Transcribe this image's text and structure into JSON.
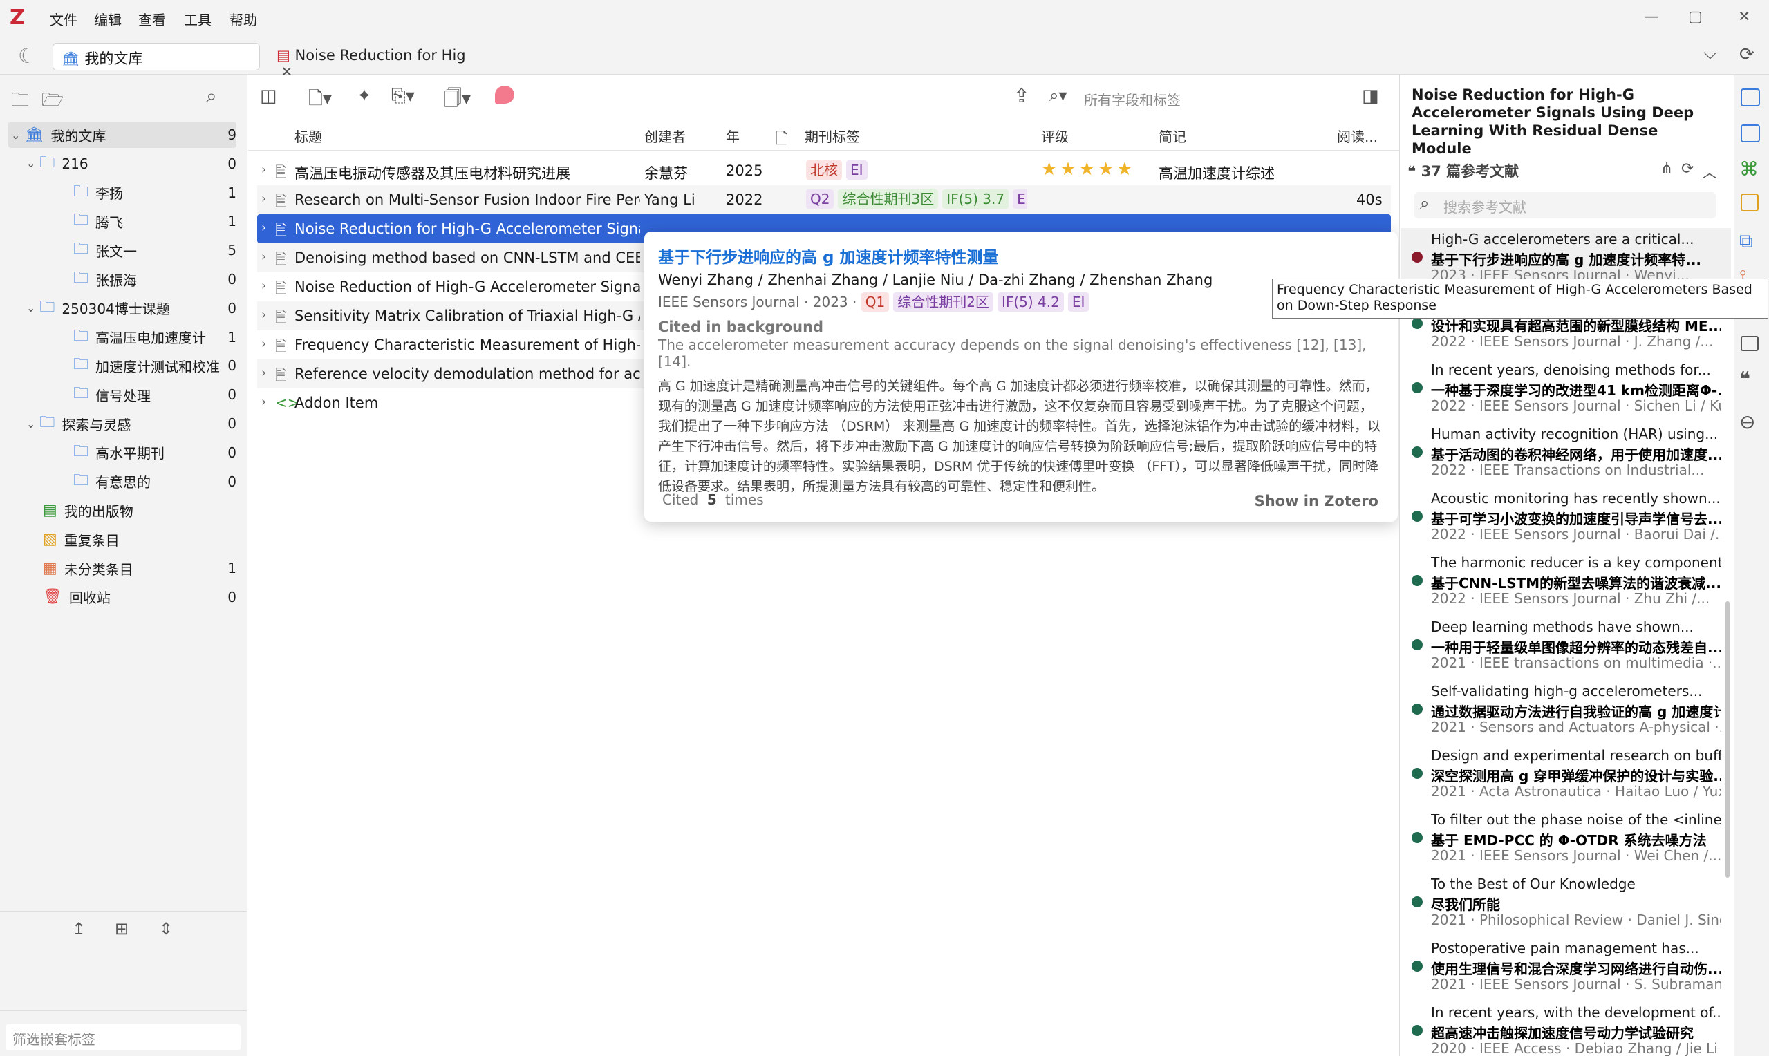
{
  "app": {
    "logo": "Z"
  },
  "menu": [
    "文件",
    "编辑",
    "查看",
    "工具",
    "帮助"
  ],
  "window": {
    "min": "—",
    "max": "▢",
    "close": "✕"
  },
  "tabs": {
    "library": "我的文库",
    "doc": "Noise Reduction for Hig",
    "close": "✕"
  },
  "collections": [
    {
      "name": "我的文库",
      "count": "9",
      "level": 0,
      "type": "lib",
      "expanded": true,
      "selected": true
    },
    {
      "name": "216",
      "count": "0",
      "level": 1,
      "type": "folder",
      "expanded": true
    },
    {
      "name": "李扬",
      "count": "1",
      "level": 2,
      "type": "folder"
    },
    {
      "name": "腾飞",
      "count": "1",
      "level": 2,
      "type": "folder"
    },
    {
      "name": "张文一",
      "count": "5",
      "level": 2,
      "type": "folder"
    },
    {
      "name": "张振海",
      "count": "0",
      "level": 2,
      "type": "folder"
    },
    {
      "name": "250304博士课题",
      "count": "0",
      "level": 1,
      "type": "folder",
      "expanded": true
    },
    {
      "name": "高温压电加速度计",
      "count": "1",
      "level": 2,
      "type": "folder"
    },
    {
      "name": "加速度计测试和校准",
      "count": "0",
      "level": 2,
      "type": "folder"
    },
    {
      "name": "信号处理",
      "count": "0",
      "level": 2,
      "type": "folder"
    },
    {
      "name": "探索与灵感",
      "count": "0",
      "level": 1,
      "type": "folder",
      "expanded": true
    },
    {
      "name": "高水平期刊",
      "count": "0",
      "level": 2,
      "type": "folder"
    },
    {
      "name": "有意思的",
      "count": "0",
      "level": 2,
      "type": "folder"
    },
    {
      "name": "我的出版物",
      "count": "",
      "level": 1,
      "type": "pub"
    },
    {
      "name": "重复条目",
      "count": "",
      "level": 1,
      "type": "dup"
    },
    {
      "name": "未分类条目",
      "count": "1",
      "level": 1,
      "type": "unfiled"
    },
    {
      "name": "回收站",
      "count": "0",
      "level": 1,
      "type": "trash"
    }
  ],
  "tag_filter_placeholder": "筛选嵌套标签",
  "search_placeholder": "所有字段和标签",
  "columns": {
    "title": "标题",
    "creator": "创建者",
    "year": "年",
    "tags": "期刊标签",
    "rating": "评级",
    "extra": "简记",
    "read": "阅读..."
  },
  "items": [
    {
      "title": "高温压电振动传感器及其压电材料研究进展",
      "creator": "余慧芬",
      "year": "2025",
      "tags": [
        {
          "t": "北核",
          "c": "red"
        },
        {
          "t": "EI",
          "c": "pur"
        }
      ],
      "rating": 5,
      "extra": "高温加速度计综述",
      "read": ""
    },
    {
      "title": "Research on Multi-Sensor Fusion Indoor Fire Percep",
      "creator": "Yang Li",
      "year": "2022",
      "tags": [
        {
          "t": "Q2",
          "c": "pur"
        },
        {
          "t": "综合性期刊3区",
          "c": "grn"
        },
        {
          "t": "IF(5) 3.7",
          "c": "grn"
        },
        {
          "t": "EI",
          "c": "pur"
        }
      ],
      "rating": 0,
      "extra": "",
      "read": "40s"
    },
    {
      "title": "Noise Reduction for High-G Accelerometer Signals U",
      "creator": "",
      "year": "",
      "tags": [],
      "rating": 0,
      "extra": "",
      "read": "",
      "selected": true
    },
    {
      "title": "Denoising method based on CNN-LSTM and CEEMD",
      "creator": "",
      "year": "",
      "tags": [],
      "rating": 0,
      "extra": "",
      "read": ""
    },
    {
      "title": "Noise Reduction of High-G Accelerometer Signals B",
      "creator": "",
      "year": "",
      "tags": [],
      "rating": 0,
      "extra": "",
      "read": ""
    },
    {
      "title": "Sensitivity Matrix Calibration of Triaxial High-G Acce",
      "creator": "",
      "year": "",
      "tags": [],
      "rating": 0,
      "extra": "",
      "read": ""
    },
    {
      "title": "Frequency Characteristic Measurement of High-G Ac",
      "creator": "",
      "year": "",
      "tags": [],
      "rating": 0,
      "extra": "",
      "read": ""
    },
    {
      "title": "Reference velocity demodulation method for accele",
      "creator": "",
      "year": "",
      "tags": [],
      "rating": 0,
      "extra": "",
      "read": ""
    },
    {
      "title": "Addon Item",
      "creator": "",
      "year": "",
      "tags": [],
      "rating": 0,
      "extra": "",
      "read": "",
      "addon": true
    }
  ],
  "popup": {
    "title": "基于下行步进响应的高 g 加速度计频率特性测量",
    "authors": "Wenyi Zhang / Zhenhai Zhang / Lanjie Niu / Da-zhi Zhang / Zhenshan Zhang",
    "journal": "IEEE Sensors Journal",
    "sep": "·",
    "year": "2023",
    "tags": [
      {
        "t": "Q1",
        "c": "red"
      },
      {
        "t": "综合性期刊2区",
        "c": "pur"
      },
      {
        "t": "IF(5) 4.2",
        "c": "pur"
      },
      {
        "t": "EI",
        "c": "pur"
      }
    ],
    "cited_in": "Cited in background",
    "context": "The accelerometer measurement accuracy depends on the signal denoising's effectiveness [12], [13], [14].",
    "abstract": "高 G 加速度计是精确测量高冲击信号的关键组件。每个高 G 加速度计都必须进行频率校准，以确保其测量的可靠性。然而，现有的测量高 G 加速度计频率响应的方法使用正弦冲击进行激励，这不仅复杂而且容易受到噪声干扰。为了克服这个问题，我们提出了一种下步响应方法 （DSRM） 来测量高 G 加速度计的频率特性。首先，选择泡沫铝作为冲击试验的缓冲材料，以产生下行冲击信号。然后，将下步冲击激励下高 G 加速度计的响应信号转换为阶跃响应信号;最后，提取阶跃响应信号中的特征，计算加速度计的频率特性。实验结果表明，DSRM 优于传统的快速傅里叶变换 （FFT），可以显著降低噪声干扰，同时降低设备要求。结果表明，所提测量方法具有较高的可靠性、稳定性和便利性。",
    "cited_label": "Cited",
    "cited_count": "5",
    "cited_suffix": "times",
    "show_in": "Show in Zotero"
  },
  "tooltip": "Frequency Characteristic Measurement of High-G Accelerometers Based on Down-Step Response",
  "right": {
    "title": "Noise Reduction for High-G Accelerometer Signals Using Deep Learning With Residual Dense Module",
    "refs_header": "37 篇参考文献",
    "refs_search": "搜索参考文献",
    "refs": [
      {
        "l1": "High-G accelerometers are a critical...",
        "l2": "基于下行步进响应的高 g 加速度计频率特...",
        "l3": "2023 · IEEE Sensors Journal · Wenyi...",
        "dot": "#8b1a2b"
      },
      {
        "l1": "",
        "l2": "设计和实现具有超高范围的新型膜线结构 ME...",
        "l3": "2022 · IEEE Sensors Journal · J. Zhang /...",
        "dot": "#1f6b4f"
      },
      {
        "l1": "In recent years, denoising methods for...",
        "l2": "一种基于深度学习的改进型41 km检测距离Φ-...",
        "l3": "2022 · IEEE Sensors Journal · Sichen Li / Ku...",
        "dot": "#1f6b4f"
      },
      {
        "l1": "Human activity recognition (HAR) using...",
        "l2": "基于活动图的卷积神经网络，用于使用加速度...",
        "l3": "2022 · IEEE Transactions on Industrial...",
        "dot": "#1f6b4f"
      },
      {
        "l1": "Acoustic monitoring has recently shown...",
        "l2": "基于可学习小波变换的加速度引导声学信号去...",
        "l3": "2022 · IEEE Sensors Journal · Baorui Dai /...",
        "dot": "#1f6b4f"
      },
      {
        "l1": "The harmonic reducer is a key component ...",
        "l2": "基于CNN-LSTM的新型去噪算法的谐波衰减...",
        "l3": "2022 · IEEE Sensors Journal · Zhu Zhi /...",
        "dot": "#1f6b4f"
      },
      {
        "l1": "Deep learning methods have shown...",
        "l2": "一种用于轻量级单图像超分辨率的动态残差自...",
        "l3": "2021 · IEEE transactions on multimedia ·...",
        "dot": "#1f6b4f"
      },
      {
        "l1": "Self-validating high-g accelerometers...",
        "l2": "通过数据驱动方法进行自我验证的高 g 加速度计",
        "l3": "2021 · Sensors and Actuators A-physical ·...",
        "dot": "#1f6b4f"
      },
      {
        "l1": "Design and experimental research on buffe...",
        "l2": "深空探测用高 g 穿甲弹缓冲保护的设计与实验...",
        "l3": "2021 · Acta Astronautica · Haitao Luo / Yuxi...",
        "dot": "#1f6b4f"
      },
      {
        "l1": "To filter out the phase noise of the <inline-...",
        "l2": "基于 EMD-PCC 的 Φ-OTDR 系统去噪方法",
        "l3": "2021 · IEEE Sensors Journal · Wei Chen /...",
        "dot": "#1f6b4f"
      },
      {
        "l1": "To the Best of Our Knowledge",
        "l2": "尽我们所能",
        "l3": "2021 · Philosophical Review · Daniel J. Singer",
        "dot": "#1f6b4f"
      },
      {
        "l1": "Postoperative pain management has...",
        "l2": "使用生理信号和混合深度学习网络进行自动伤...",
        "l3": "2021 · IEEE Sensors Journal · S. Subramania...",
        "dot": "#1f6b4f"
      },
      {
        "l1": "In recent years, with the development of...",
        "l2": "超高速冲击触探加速度信号动力学试验研究",
        "l3": "2020 · IEEE Access · Debiao Zhang / Jie Li /...",
        "dot": "#1f6b4f"
      }
    ]
  },
  "colors": {
    "accent": "#3b7ddd",
    "selection": "#3064d6",
    "brand": "#cc2936"
  }
}
